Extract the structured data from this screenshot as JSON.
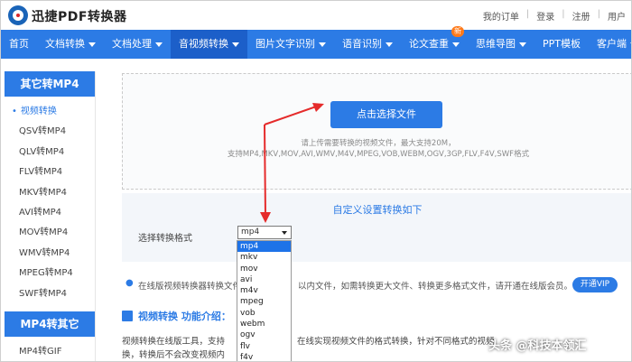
{
  "header": {
    "brand": "迅捷PDF转换器",
    "links": [
      "我的订单",
      "登录",
      "注册",
      "用户"
    ]
  },
  "nav": {
    "items": [
      {
        "label": "首页",
        "caret": false,
        "active": false
      },
      {
        "label": "文档转换",
        "caret": true,
        "active": false
      },
      {
        "label": "文档处理",
        "caret": true,
        "active": false
      },
      {
        "label": "音视频转换",
        "caret": true,
        "active": true
      },
      {
        "label": "图片文字识别",
        "caret": true,
        "active": false
      },
      {
        "label": "语音识别",
        "caret": true,
        "active": false
      },
      {
        "label": "论文查重",
        "caret": true,
        "active": false,
        "badge": "新"
      },
      {
        "label": "思维导图",
        "caret": true,
        "active": false
      },
      {
        "label": "PPT模板",
        "caret": false,
        "active": false
      },
      {
        "label": "客户端",
        "caret": true,
        "active": false
      }
    ]
  },
  "sidebar": {
    "section1_title": "其它转MP4",
    "section1_items": [
      "视频转换",
      "QSV转MP4",
      "QLV转MP4",
      "FLV转MP4",
      "MKV转MP4",
      "AVI转MP4",
      "MOV转MP4",
      "WMV转MP4",
      "MPEG转MP4",
      "SWF转MP4"
    ],
    "section2_title": "MP4转其它",
    "section2_items": [
      "MP4转GIF"
    ]
  },
  "upload": {
    "button": "点击选择文件",
    "tip1": "请上传需要转换的视频文件，最大支持20M，",
    "tip2": "支持MP4,MKV,MOV,AVI,WMV,M4V,MPEG,VOB,WEBM,OGV,3GP,FLV,F4V,SWF格式"
  },
  "settings": {
    "title": "自定义设置转换如下",
    "format_label": "选择转换格式",
    "selected_format": "mp4",
    "options": [
      "mp4",
      "mkv",
      "mov",
      "avi",
      "m4v",
      "mpeg",
      "vob",
      "webm",
      "ogv",
      "flv",
      "f4v"
    ]
  },
  "notice": {
    "text_part1": "在线版视频转换器转换文件",
    "text_part2": "以内文件，如需转换更大文件、转换更多格式文件，请开通在线版会员。",
    "vip_button": "开通VIP"
  },
  "intro": {
    "title_main": "视频转换",
    "title_sub": " 功能介绍：",
    "line1_a": "视频转换在线版工具，支持",
    "line1_b": "在线实现视频文件的格式转换，针对不同格式的视频",
    "line2": "换，转换后不会改变视频内"
  },
  "watermark": "头条 @科技本领汇",
  "colors": {
    "brand_blue": "#2c7be5",
    "annotation_red": "#e52b2b"
  }
}
